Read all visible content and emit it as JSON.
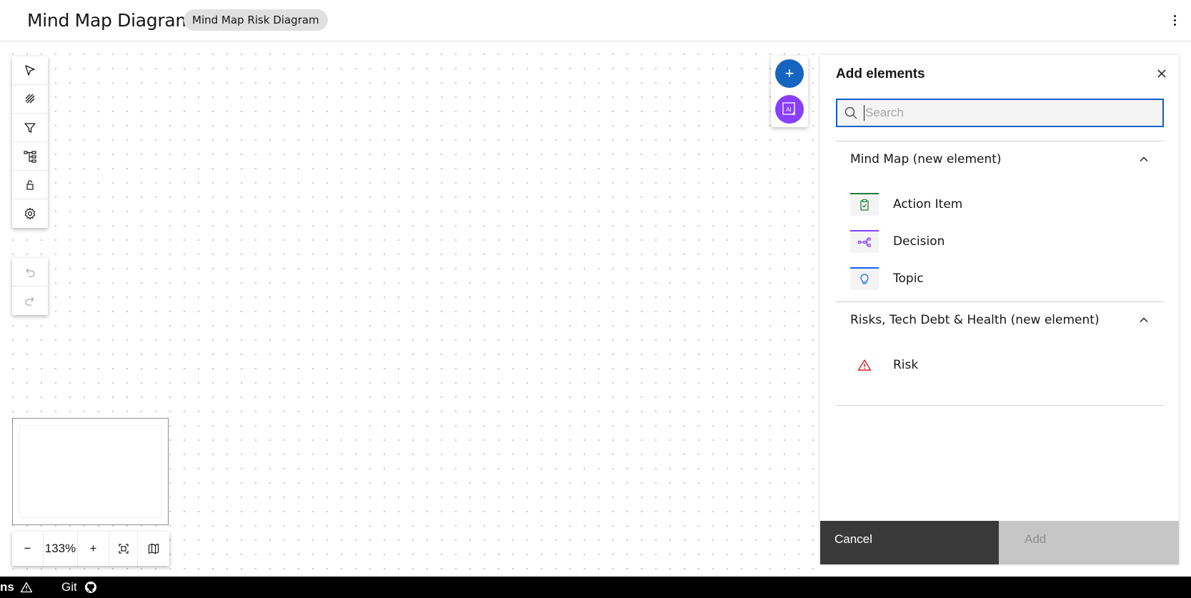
{
  "header": {
    "title": "Mind Map Diagram",
    "tag": "Mind Map Risk Diagram"
  },
  "toolbar": {
    "tools": [
      "pointer-icon",
      "connector-icon",
      "filter-icon",
      "hierarchy-icon",
      "lock-icon",
      "settings-icon"
    ],
    "history": [
      "undo-icon",
      "redo-icon"
    ]
  },
  "zoom": {
    "minus": "−",
    "value": "133%",
    "plus": "+"
  },
  "panel": {
    "title": "Add elements",
    "search_placeholder": "Search",
    "sections": [
      {
        "title": "Mind Map (new element)",
        "items": [
          {
            "label": "Action Item",
            "icon": "clipboard-check-icon",
            "color": "#24a148"
          },
          {
            "label": "Decision",
            "icon": "decision-tree-icon",
            "color": "#8a3ffc"
          },
          {
            "label": "Topic",
            "icon": "lightbulb-icon",
            "color": "#0f62fe"
          }
        ]
      },
      {
        "title": "Risks, Tech Debt & Health (new element)",
        "items": [
          {
            "label": "Risk",
            "icon": "warning-triangle-icon",
            "color": "#da1e28"
          }
        ]
      }
    ],
    "cancel_label": "Cancel",
    "add_label": "Add"
  },
  "fabs": {
    "add": "+",
    "ai": "AI"
  },
  "statusbar": {
    "notifications_fragment": "ns",
    "git_label": "Git"
  },
  "colors": {
    "primary": "#1565c0",
    "ai": "#8a3ffc",
    "footer_dark": "#393939",
    "disabled": "#c6c6c6"
  }
}
